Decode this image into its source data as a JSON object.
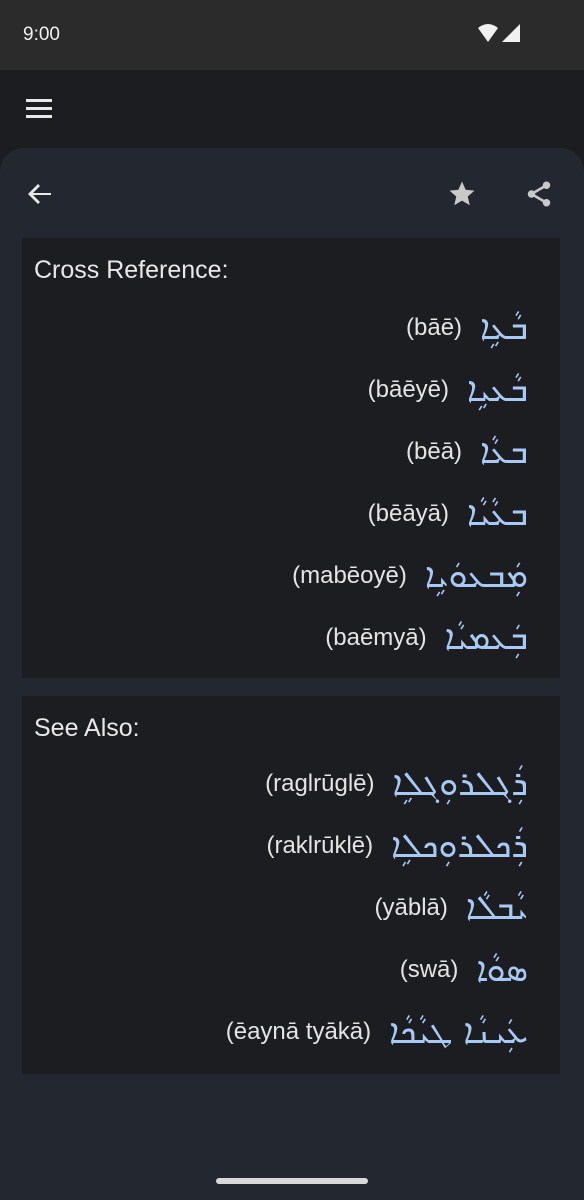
{
  "status": {
    "time": "9:00"
  },
  "toolbar": {
    "back_icon": "arrow-left-icon",
    "star_icon": "star-icon",
    "share_icon": "share-icon"
  },
  "cross_reference": {
    "title": "Cross Reference:",
    "entries": [
      {
        "translit": "(bāē)",
        "syriac": "ܒܵܥܹܐ"
      },
      {
        "translit": "(bāēyē)",
        "syriac": "ܒܵܥܝܹܐ"
      },
      {
        "translit": "(bēā)",
        "syriac": "ܒܥܵܐ"
      },
      {
        "translit": "(bēāyā)",
        "syriac": "ܒܥܵܝܵܐ"
      },
      {
        "translit": "(mabēoyē)",
        "syriac": "ܡܲܒܥܘܿܝܹܐ"
      },
      {
        "translit": "(baēmyā)",
        "syriac": "ܒܲܥܡܝܵܐ"
      }
    ]
  },
  "see_also": {
    "title": "See Also:",
    "entries": [
      {
        "translit": "(raglrūglē)",
        "syriac": "ܪܲܓܠܪܘܼܓܠܹܐ"
      },
      {
        "translit": "(raklrūklē)",
        "syriac": "ܪܲܟܠܪܘܼܟܠܹܐ"
      },
      {
        "translit": "(yāblā)",
        "syriac": "ܝܵܒܠܵܐ"
      },
      {
        "translit": "(swā)",
        "syriac": "ܣܘܵܐ"
      },
      {
        "translit": "(ēaynā tyākā)",
        "syriac": "ܥܲܝܢܵܐ ܛܝܵܟܵܐ"
      }
    ]
  }
}
